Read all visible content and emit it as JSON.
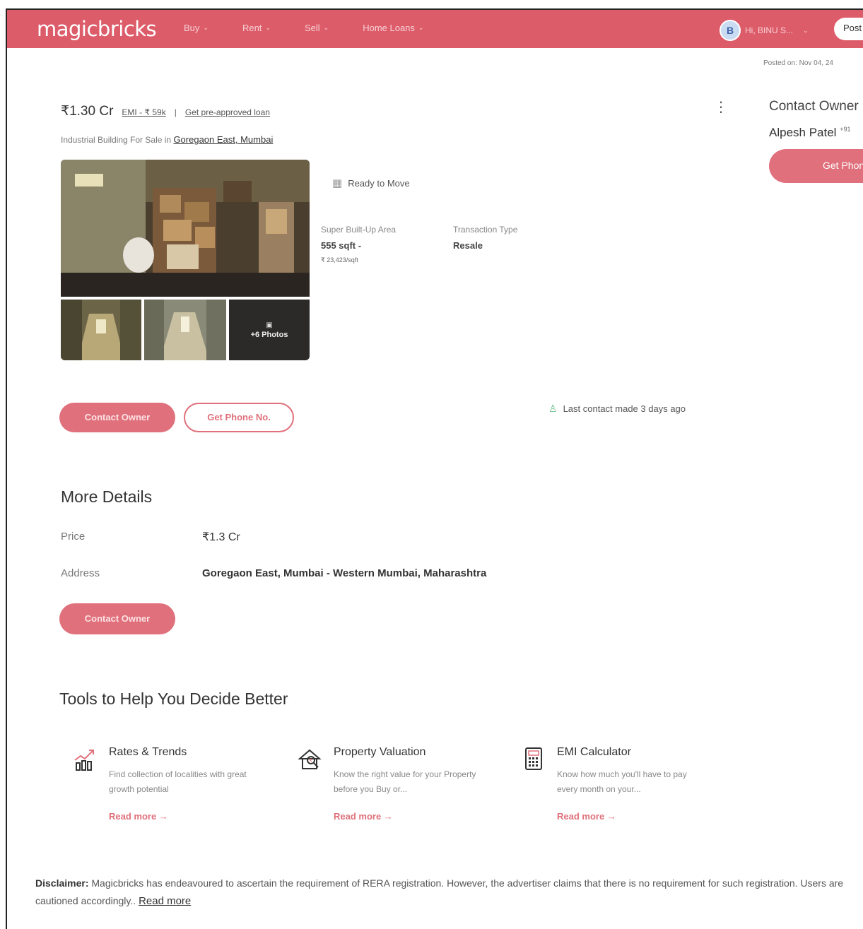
{
  "header": {
    "logo": "magicbricks",
    "nav": [
      {
        "label": "Buy"
      },
      {
        "label": "Rent"
      },
      {
        "label": "Sell"
      },
      {
        "label": "Home Loans"
      }
    ],
    "user_initial": "B",
    "user_greeting": "Hi, BINU S...",
    "post_label": "Post"
  },
  "contact_card": {
    "posted_on": "Posted on: Nov 04, 24",
    "title": "Contact Owner",
    "owner_name": "Alpesh Patel",
    "owner_suffix": "+91",
    "get_phone": "Get Phone No."
  },
  "listing": {
    "price": "₹1.30 Cr",
    "emi": "EMI - ₹ 59k",
    "separator": "|",
    "preapproved": "Get pre-approved loan",
    "subtitle_prefix": "Industrial Building For Sale in",
    "location": "Goregaon East, Mumbai",
    "photos_more": "+6 Photos",
    "status": "Ready to Move",
    "area_label": "Super Built-Up Area",
    "area_value": "555 sqft -",
    "area_rate": "₹ 23,423/sqft",
    "transaction_label": "Transaction Type",
    "transaction_value": "Resale",
    "contact_owner": "Contact Owner",
    "get_phone": "Get Phone No.",
    "last_contact": "Last contact made 3 days ago"
  },
  "more_details": {
    "title": "More Details",
    "rows": [
      {
        "label": "Price",
        "value": "₹1.3 Cr"
      },
      {
        "label": "Address",
        "value": "Goregaon East, Mumbai - Western Mumbai, Maharashtra"
      }
    ],
    "contact_owner": "Contact Owner"
  },
  "tools": {
    "title": "Tools to Help You Decide Better",
    "items": [
      {
        "icon": "rates-trends-icon",
        "title": "Rates & Trends",
        "desc": "Find collection of localities with great growth potential",
        "more": "Read more →"
      },
      {
        "icon": "property-valuation-icon",
        "title": "Property Valuation",
        "desc": "Know the right value for your Property before you Buy or...",
        "more": "Read more →"
      },
      {
        "icon": "emi-calculator-icon",
        "title": "EMI Calculator",
        "desc": "Know how much you'll have to pay every month on your...",
        "more": "Read more →"
      }
    ]
  },
  "disclaimer": {
    "label": "Disclaimer:",
    "text": "Magicbricks has endeavoured to ascertain the requirement of RERA registration. However, the advertiser claims that there is no requirement for such registration. Users are cautioned accordingly..",
    "read_more": "Read more"
  },
  "colors": {
    "brand": "#dd5c6a",
    "button": "#e0707b",
    "status_green": "#6cc08b"
  }
}
